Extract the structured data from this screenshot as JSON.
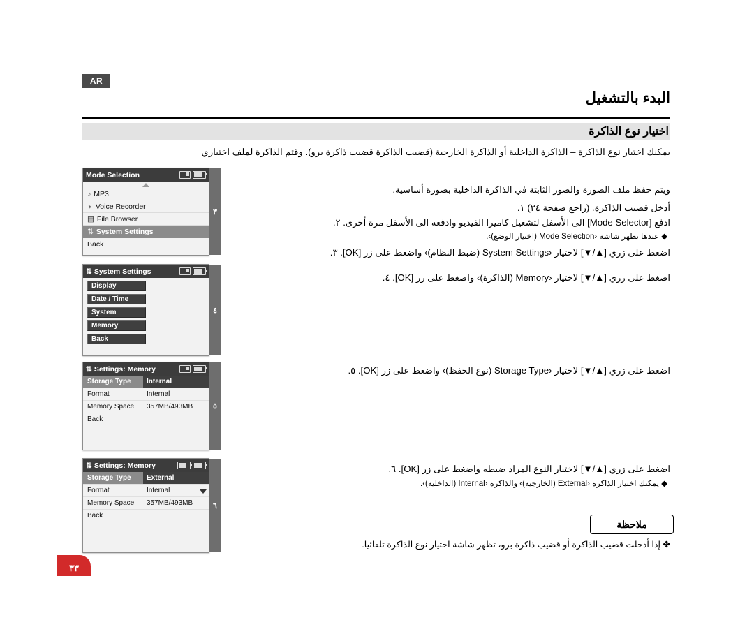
{
  "header": {
    "lang_badge": "AR",
    "title": "البدء بالتشغيل",
    "section": "اختيار نوع الذاكرة"
  },
  "intro": {
    "para1": "يمكنك اختيار نوع الذاكرة – الذاكرة الداخلية أو الذاكرة الخارجية (قضيب الذاكرة قضيب ذاكرة برو). وقتم الذاكرة لملف اختياري",
    "para2": "ويتم حفظ ملف الصورة والصور الثابتة في الذاكرة الداخلية بصورة أساسية."
  },
  "steps": [
    {
      "num": "١.",
      "text": "أدخل قضيب الذاكرة. (راجع صفحة ٣٤)"
    },
    {
      "num": "٢.",
      "text": "ادفع [Mode Selector] الى الأسفل لتشغيل كاميرا الفيديو وادفعه الى الأسفل مرة أخرى."
    },
    {
      "num": "٣.",
      "text": "اضغط على زري [▲/▼] لاختيار ‹System Settings (ضبط النظام)› واضغط على زر [OK]."
    },
    {
      "num": "٤.",
      "text": "اضغط على زري [▲/▼] لاختيار ‹Memory (الذاكرة)› واضغط على زر [OK]."
    },
    {
      "num": "٥.",
      "text": "اضغط على زري [▲/▼] لاختيار ‹Storage Type (نوع الحفظ)› واضغط على زر [OK]."
    },
    {
      "num": "٦.",
      "text": "اضغط على زري [▲/▼] لاختيار النوع المراد ضبطه واضغط على زر [OK]."
    }
  ],
  "bullets": [
    "◆ عندها تظهر شاشة ‹Mode Selection (اختيار الوضع)›.",
    "◆ يمكنك اختيار الذاكرة ‹External (الخارجية)› والذاكرة ‹Internal (الداخلية)›."
  ],
  "note": {
    "title": "ملاحظة",
    "text": "✤ إذا أدخلت قضيب الذاكرة أو قضيب ذاكرة برو، تظهر شاشة اختيار نوع الذاكرة تلقائيا."
  },
  "page_number": "٣٣",
  "screens": [
    {
      "step_tag": "٣",
      "title": "Mode Selection",
      "icons": [
        "card-icon",
        "battery-icon"
      ],
      "type": "menu",
      "items": [
        {
          "label": "MP3",
          "icon": "music-note-icon",
          "selected": false
        },
        {
          "label": "Voice Recorder",
          "icon": "microphone-icon",
          "selected": false
        },
        {
          "label": "File Browser",
          "icon": "folder-icon",
          "selected": false
        },
        {
          "label": "System Settings",
          "icon": "settings-icon",
          "selected": true
        },
        {
          "label": "Back",
          "icon": "",
          "selected": false
        }
      ]
    },
    {
      "step_tag": "٤",
      "title": "System Settings",
      "title_icon": "settings-icon",
      "icons": [
        "card-icon",
        "battery-icon"
      ],
      "type": "buttons",
      "items": [
        {
          "label": "Display",
          "selected": false
        },
        {
          "label": "Date / Time",
          "selected": false
        },
        {
          "label": "System",
          "selected": false
        },
        {
          "label": "Memory",
          "selected": true
        },
        {
          "label": "Back",
          "selected": true
        }
      ]
    },
    {
      "step_tag": "٥",
      "title": "Settings: Memory",
      "title_icon": "settings-icon",
      "icons": [
        "card-icon",
        "battery-icon"
      ],
      "type": "table",
      "rows": [
        {
          "label": "Storage Type",
          "value": "Internal",
          "selected": true,
          "chevron": false
        },
        {
          "label": "Format",
          "value": "Internal",
          "selected": false,
          "chevron": false
        },
        {
          "label": "Memory Space",
          "value": "357MB/493MB",
          "selected": false,
          "chevron": false
        },
        {
          "label": "Back",
          "value": "",
          "selected": false,
          "chevron": false
        }
      ]
    },
    {
      "step_tag": "٦",
      "title": "Settings: Memory",
      "title_icon": "settings-icon",
      "icons": [
        "battery-icon",
        "battery-icon"
      ],
      "type": "table",
      "rows": [
        {
          "label": "Storage Type",
          "value": "External",
          "selected": true,
          "chevron": false
        },
        {
          "label": "Format",
          "value": "Internal",
          "selected": false,
          "chevron": true
        },
        {
          "label": "Memory Space",
          "value": "357MB/493MB",
          "selected": false,
          "chevron": false
        },
        {
          "label": "Back",
          "value": "",
          "selected": false,
          "chevron": false
        }
      ]
    }
  ]
}
